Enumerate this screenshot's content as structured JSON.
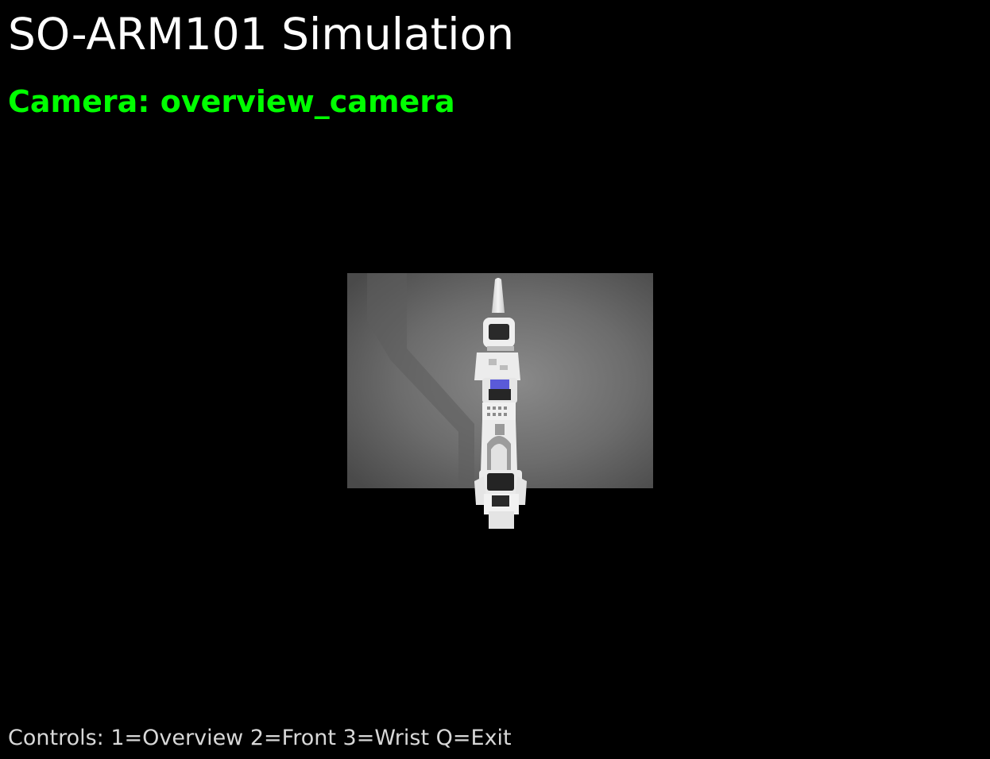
{
  "window": {
    "title": "SO-ARM101 Simulation"
  },
  "camera": {
    "label": "Camera: overview_camera"
  },
  "footer": {
    "controls": "Controls: 1=Overview 2=Front 3=Wrist Q=Exit"
  },
  "viewport": {
    "scene": "robot-arm-top-view",
    "colors": {
      "background_light": "#7a7a7a",
      "background_dark": "#4e4e4e",
      "arm": "#ededed",
      "joint_dark": "#2a2a2a",
      "accent": "#5a5ad8"
    }
  },
  "accent_colors": {
    "title": "#ffffff",
    "camera_label": "#00ff00",
    "controls": "#d8d8d8"
  }
}
